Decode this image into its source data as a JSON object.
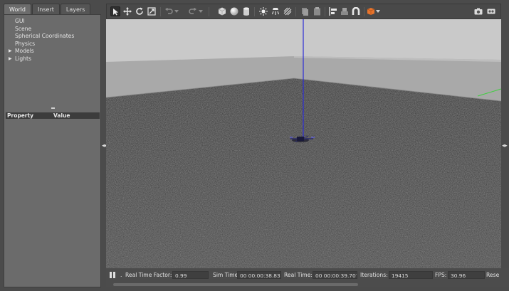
{
  "tabs": [
    {
      "label": "World",
      "active": true
    },
    {
      "label": "Insert",
      "active": false
    },
    {
      "label": "Layers",
      "active": false
    }
  ],
  "world_tree": [
    {
      "label": "GUI",
      "expandable": false
    },
    {
      "label": "Scene",
      "expandable": false
    },
    {
      "label": "Spherical Coordinates",
      "expandable": false
    },
    {
      "label": "Physics",
      "expandable": false
    },
    {
      "label": "Models",
      "expandable": true
    },
    {
      "label": "Lights",
      "expandable": true
    }
  ],
  "property_table": {
    "col_property": "Property",
    "col_value": "Value"
  },
  "toolbar": {
    "tools": [
      "select-arrow-icon",
      "translate-icon",
      "rotate-icon",
      "scale-icon",
      "undo-icon",
      "redo-icon",
      "box-icon",
      "sphere-icon",
      "cylinder-icon",
      "point-light-icon",
      "spot-light-icon",
      "directional-light-icon",
      "copy-icon",
      "paste-icon",
      "align-icon",
      "magnet-icon",
      "view-angle-icon",
      "screenshot-icon",
      "record-icon"
    ],
    "active_tool": "select-arrow-icon",
    "accent_color": "#e8742c"
  },
  "status": {
    "real_time_factor_label": "Real Time Factor:",
    "real_time_factor": "0.99",
    "sim_time_label": "Sim Time:",
    "sim_time": "00 00:00:38.830",
    "real_time_label": "Real Time:",
    "real_time": "00 00:00:39.707",
    "iterations_label": "Iterations:",
    "iterations": "19415",
    "fps_label": "FPS:",
    "fps": "30.96",
    "reset_label": "Rese"
  },
  "colors": {
    "z_axis": "#2d2dd6",
    "y_axis": "#3fcf3f",
    "panel_bg": "#6b6b6b",
    "sky": "#c9c9c9",
    "ground": "#4d4d4d"
  }
}
